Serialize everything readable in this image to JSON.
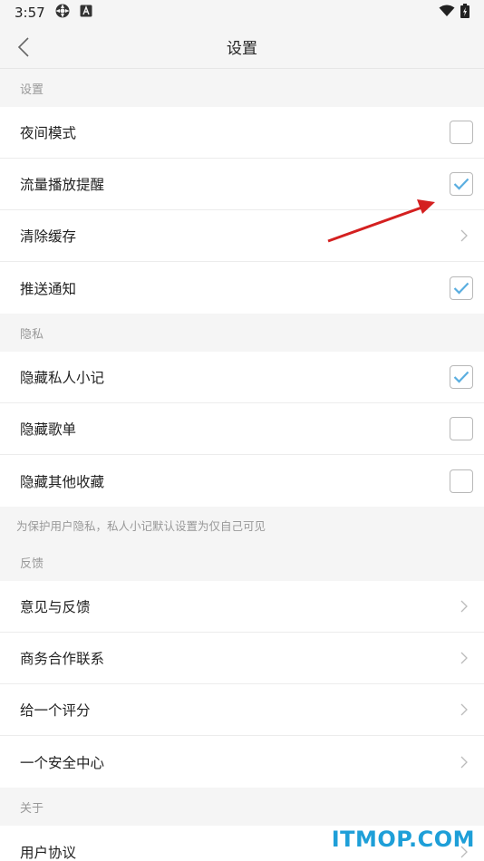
{
  "status_bar": {
    "time": "3:57"
  },
  "nav": {
    "title": "设置"
  },
  "sections": {
    "settings": {
      "header": "设置",
      "items": [
        {
          "label": "夜间模式",
          "control": "checkbox",
          "checked": false
        },
        {
          "label": "流量播放提醒",
          "control": "checkbox",
          "checked": true
        },
        {
          "label": "清除缓存",
          "control": "chevron"
        },
        {
          "label": "推送通知",
          "control": "checkbox",
          "checked": true
        }
      ]
    },
    "privacy": {
      "header": "隐私",
      "items": [
        {
          "label": "隐藏私人小记",
          "control": "checkbox",
          "checked": true
        },
        {
          "label": "隐藏歌单",
          "control": "checkbox",
          "checked": false
        },
        {
          "label": "隐藏其他收藏",
          "control": "checkbox",
          "checked": false
        }
      ],
      "note": "为保护用户隐私，私人小记默认设置为仅自己可见"
    },
    "feedback": {
      "header": "反馈",
      "items": [
        {
          "label": "意见与反馈",
          "control": "chevron"
        },
        {
          "label": "商务合作联系",
          "control": "chevron"
        },
        {
          "label": "给一个评分",
          "control": "chevron"
        },
        {
          "label": "一个安全中心",
          "control": "chevron"
        }
      ]
    },
    "about": {
      "header": "关于",
      "items": [
        {
          "label": "用户协议",
          "control": "chevron"
        }
      ]
    }
  },
  "watermark": "ITMOP.COM",
  "colors": {
    "check": "#5aaee0",
    "arrow": "#d42020",
    "watermark": "#1e9fd8"
  }
}
